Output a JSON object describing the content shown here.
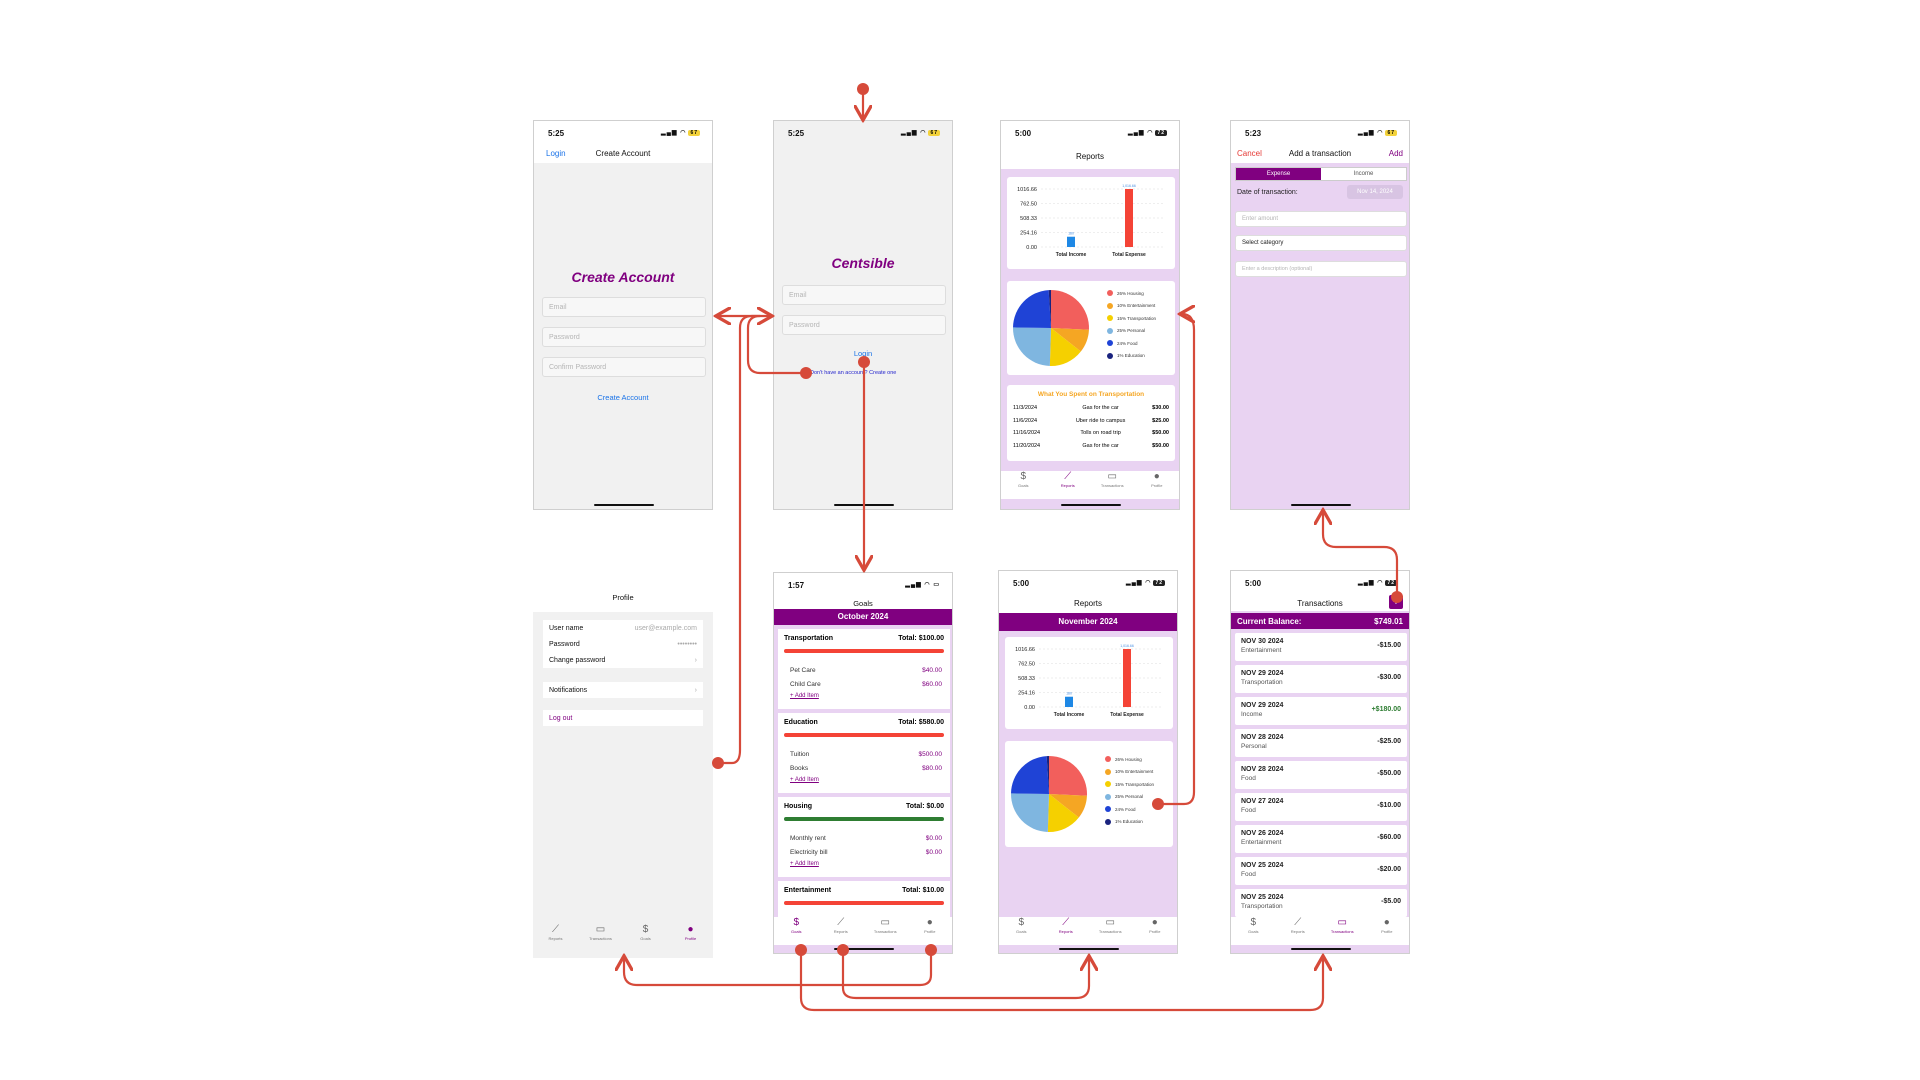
{
  "colors": {
    "brand": "#800080",
    "panel_purple": "#e9d3f2",
    "expense_red": "#f44336",
    "income_blue": "#1e88e5",
    "success_green": "#2e7d32",
    "flow_arrow": "#d64a3a"
  },
  "create_account": {
    "time": "5:25",
    "battery": "67",
    "back_link": "Login",
    "nav_title": "Create Account",
    "heading": "Create Account",
    "email_placeholder": "Email",
    "password_placeholder": "Password",
    "confirm_placeholder": "Confirm Password",
    "submit": "Create Account"
  },
  "login": {
    "time": "5:25",
    "battery": "67",
    "heading": "Centsible",
    "email_placeholder": "Email",
    "password_placeholder": "Password",
    "submit": "Login",
    "signup_link": "Don't have an account? Create one"
  },
  "reports_top": {
    "time": "5:00",
    "battery": "72",
    "title": "Reports",
    "transport_heading": "What You Spent on Transportation",
    "transport_rows": [
      {
        "date": "11/3/2024",
        "desc": "Gas for the car",
        "amount": "$30.00"
      },
      {
        "date": "11/6/2024",
        "desc": "Uber ride to campus",
        "amount": "$25.00"
      },
      {
        "date": "11/16/2024",
        "desc": "Tolls on road trip",
        "amount": "$50.00"
      },
      {
        "date": "11/20/2024",
        "desc": "Gas for the car",
        "amount": "$50.00"
      }
    ]
  },
  "reports_bottom": {
    "time": "5:00",
    "battery": "72",
    "title": "Reports",
    "month": "November 2024"
  },
  "chart_data": [
    {
      "type": "bar",
      "categories": [
        "Total Income",
        "Total Expense"
      ],
      "values": [
        180,
        1016.66
      ],
      "yticks": [
        "1016.66",
        "762.50",
        "508.33",
        "254.16",
        "0.00"
      ],
      "ylim": [
        0,
        1016.66
      ],
      "value_labels": [
        "180",
        "1,016.66"
      ]
    },
    {
      "type": "pie",
      "labels": [
        "26% Housing",
        "10% Entertainment",
        "15% Transportation",
        "25% Personal",
        "24% Food",
        "1% Education"
      ],
      "values": [
        26,
        10,
        15,
        25,
        24,
        1
      ],
      "colors": [
        "#f25f5c",
        "#f5a623",
        "#f5d000",
        "#7fb6e0",
        "#1f43d6",
        "#1a237e"
      ]
    }
  ],
  "add_transaction": {
    "time": "5:23",
    "battery": "67",
    "cancel": "Cancel",
    "title": "Add a transaction",
    "add": "Add",
    "tab_expense": "Expense",
    "tab_income": "Income",
    "date_label": "Date of transaction:",
    "date_value": "Nov 14, 2024",
    "amount_placeholder": "Enter amount",
    "category_placeholder": "Select category",
    "desc_placeholder": "Enter a description (optional)"
  },
  "profile": {
    "title": "Profile",
    "rows": [
      {
        "label": "User name",
        "value": "user@example.com"
      },
      {
        "label": "Password",
        "value": "••••••••"
      },
      {
        "label": "Change password",
        "value": "›"
      }
    ],
    "notifications": "Notifications",
    "notifications_chev": "›",
    "logout": "Log out"
  },
  "goals": {
    "time": "1:57",
    "title": "Goals",
    "month": "October 2024",
    "add_item": "+ Add Item",
    "cards": [
      {
        "name": "Transportation",
        "total": "Total: $100.00",
        "items": [
          {
            "n": "Pet Care",
            "v": "$40.00"
          },
          {
            "n": "Child Care",
            "v": "$60.00"
          }
        ]
      },
      {
        "name": "Education",
        "total": "Total: $580.00",
        "items": [
          {
            "n": "Tuition",
            "v": "$500.00"
          },
          {
            "n": "Books",
            "v": "$80.00"
          }
        ]
      },
      {
        "name": "Housing",
        "total": "Total: $0.00",
        "items": [
          {
            "n": "Monthly rent",
            "v": "$0.00"
          },
          {
            "n": "Electricity bill",
            "v": "$0.00"
          }
        ]
      },
      {
        "name": "Entertainment",
        "total": "Total: $10.00",
        "items": []
      }
    ]
  },
  "transactions": {
    "time": "5:00",
    "battery": "72",
    "title": "Transactions",
    "add_icon": "+",
    "balance_label": "Current Balance:",
    "balance_value": "$749.01",
    "rows": [
      {
        "date": "NOV 30 2024",
        "cat": "Entertainment",
        "amount": "-$15.00"
      },
      {
        "date": "NOV 29 2024",
        "cat": "Transportation",
        "amount": "-$30.00"
      },
      {
        "date": "NOV 29 2024",
        "cat": "Income",
        "amount": "+$180.00"
      },
      {
        "date": "NOV 28 2024",
        "cat": "Personal",
        "amount": "-$25.00"
      },
      {
        "date": "NOV 28 2024",
        "cat": "Food",
        "amount": "-$50.00"
      },
      {
        "date": "NOV 27 2024",
        "cat": "Food",
        "amount": "-$10.00"
      },
      {
        "date": "NOV 26 2024",
        "cat": "Entertainment",
        "amount": "-$60.00"
      },
      {
        "date": "NOV 25 2024",
        "cat": "Food",
        "amount": "-$20.00"
      },
      {
        "date": "NOV 25 2024",
        "cat": "Transportation",
        "amount": "-$5.00"
      }
    ]
  },
  "tabs": {
    "goals": "Goals",
    "reports": "Reports",
    "transactions": "Transactions",
    "profile": "Profile"
  },
  "icons": {
    "goals": "$",
    "reports": "📈",
    "transactions": "▭",
    "profile": "👤"
  }
}
